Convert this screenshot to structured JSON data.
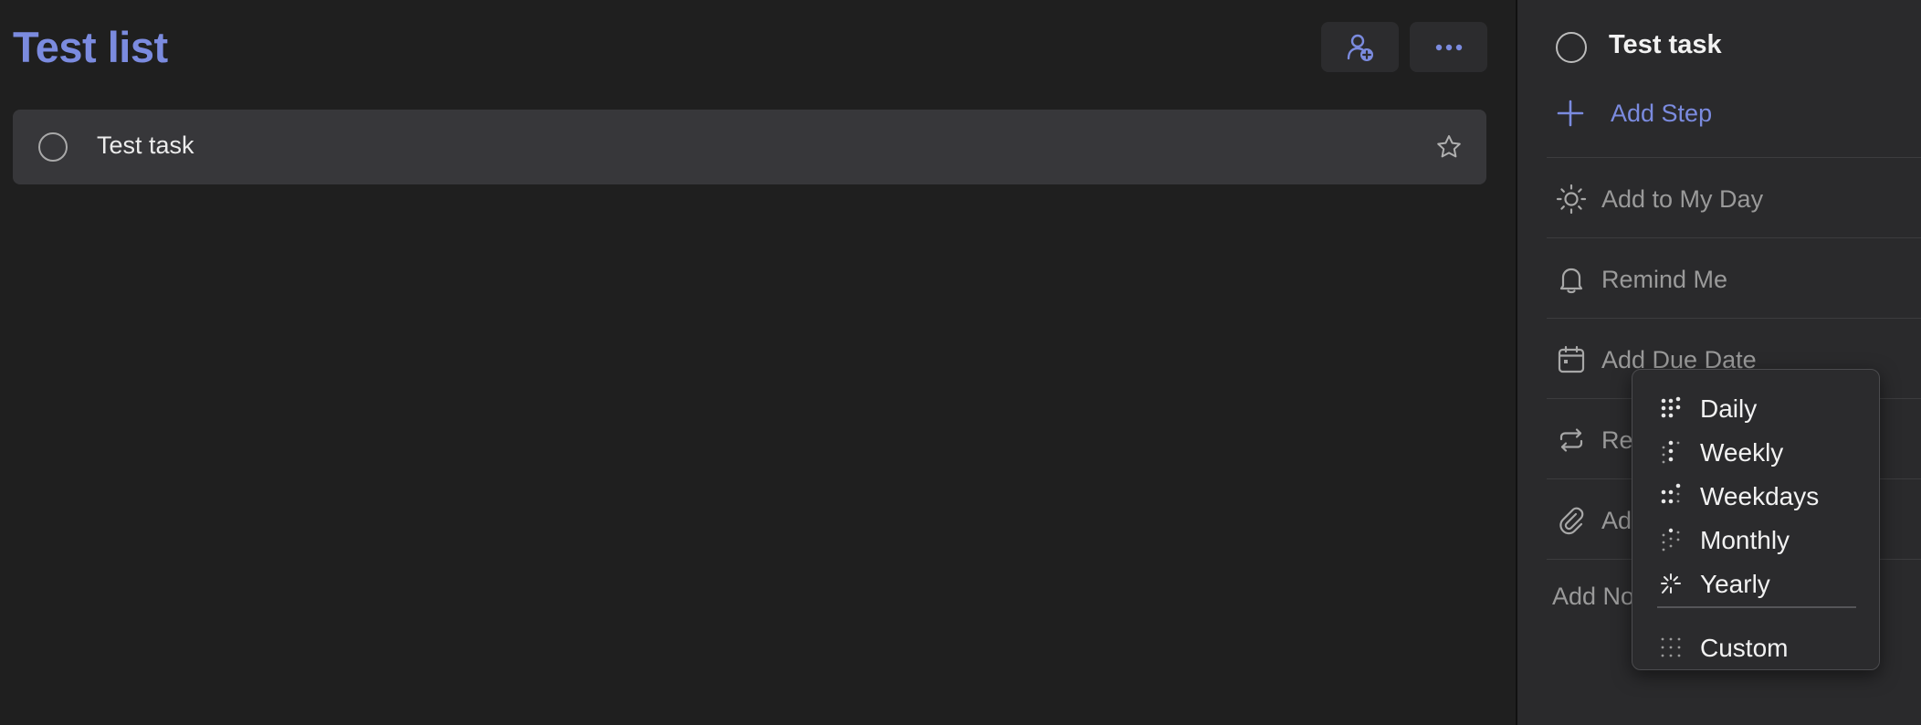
{
  "list": {
    "title": "Test list",
    "share_icon": "person-add-icon",
    "more_icon": "more-dots-icon"
  },
  "tasks": [
    {
      "title": "Test task",
      "completed": false,
      "starred": false
    }
  ],
  "detail": {
    "task_title": "Test task",
    "add_step": "Add Step",
    "add_to_my_day": "Add to My Day",
    "remind_me": "Remind Me",
    "add_due_date": "Add Due Date",
    "repeat": "Re",
    "add_file": "Ad",
    "add_note": "Add No"
  },
  "repeat_menu": {
    "items": [
      {
        "label": "Daily",
        "icon": "daily-dots-icon"
      },
      {
        "label": "Weekly",
        "icon": "weekly-dots-icon"
      },
      {
        "label": "Weekdays",
        "icon": "weekdays-dots-icon"
      },
      {
        "label": "Monthly",
        "icon": "monthly-dots-icon"
      },
      {
        "label": "Yearly",
        "icon": "yearly-sparkle-icon"
      },
      {
        "label": "Custom",
        "icon": "custom-grid-icon"
      }
    ]
  },
  "colors": {
    "accent": "#7b8bdf",
    "background": "#1f1f1f",
    "panel": "#2a2a2c",
    "task_row": "#37373a"
  }
}
